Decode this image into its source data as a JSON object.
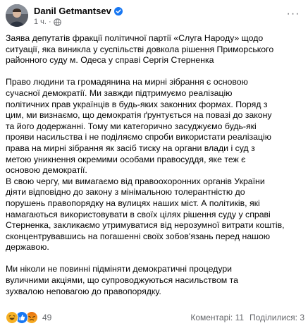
{
  "post": {
    "author": "Danil Getmantsev",
    "time": "1 ч.",
    "meta_separator": "·",
    "more_label": "···",
    "paragraphs": [
      "Заява депутатів фракції політичної партії «Слуга Народу» щодо\nситуації, яка виникла у суспільстві довкола рішення Приморського\nрайонного суду м. Одеса у справі Сергія Стерненка",
      " Право людини та громадянина на мирні зібрання є основою\nсучасної демократії. Ми завжди підтримуємо реалізацію\nполітичних прав українців в будь-яких законних формах. Поряд з\nцим, ми визнаємо, що демократія ґрунтується на повазі до закону\nта його додержанні. Тому ми категорично засуджуємо будь-які\nпрояви насильства і не поділяємо спроби використати реалізацію\nправа на мирні зібрання як засіб тиску на органи влади і суд з\nметою уникнення окремими особами правосуддя, яке теж є\nосновою демократії.",
      " В свою чергу, ми вимагаємо від правоохоронних органів України\nдіяти відповідно до закону з мінімальною толерантністю до\nпорушень правопорядку на вулицях наших міст. А політиків, які\nнамагаються використовувати в своїх цілях рішення суду у справі\nСтерненка, закликаємо утримуватися від нерозумної витрати коштів,\nсконцентрувавшись на погашенні своїх зобов'язань перед нашою\nдержавою.",
      " Ми ніколи не повинні підміняти демократичні процедури\nвуличними акціями, що супроводжуються насильством та\nзухвалою неповагою до правопорядку."
    ]
  },
  "footer": {
    "reaction_count": "49",
    "comments": "Коментарі: 11",
    "shares": "Поділилися: 3"
  },
  "colors": {
    "text": "#050505",
    "muted": "#65676b",
    "verified": "#1877f2",
    "like": "#1877f2",
    "haha": "#f7b125",
    "angry": "#e9710f"
  },
  "icons": {
    "verified": "verified-badge-icon",
    "globe": "globe-icon",
    "more": "more-options-icon",
    "reactions": [
      "haha-reaction-icon",
      "like-reaction-icon",
      "angry-reaction-icon"
    ]
  }
}
